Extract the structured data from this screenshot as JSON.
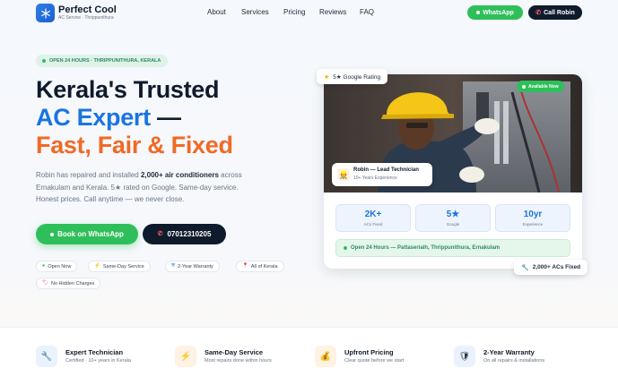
{
  "nav": {
    "brand": "Perfect Cool",
    "tagline": "AC Service · Thrippunithura",
    "links": [
      "About",
      "Services",
      "Pricing",
      "Reviews",
      "FAQ"
    ],
    "whatsapp_label": "WhatsApp",
    "call_label": "Call Robin"
  },
  "hero": {
    "badge": "OPEN 24 HOURS · THRIPPUNITHURA, KERALA",
    "line1": "Kerala's Trusted",
    "line2": "AC Expert",
    "line2_dash": " —",
    "line3": "Fast, Fair & Fixed",
    "lede_a": "Robin has repaired and installed ",
    "lede_b": "2,000+ air conditioners",
    "lede_c": " across Ernakulam and Kerala. 5★ rated on Google. Same-day service. Honest prices. Call anytime — we never close.",
    "cta_whatsapp": "Book on WhatsApp",
    "cta_phone": "07012310205",
    "chips": [
      {
        "icon": "green-dot",
        "label": "Open Now"
      },
      {
        "icon": "bolt-icon",
        "label": "Same-Day Service"
      },
      {
        "icon": "shield-icon",
        "label": "2-Year Warranty"
      },
      {
        "icon": "pin-icon",
        "label": "All of Kerala"
      },
      {
        "icon": "tag-icon",
        "label": "No Hidden Charges"
      }
    ]
  },
  "card": {
    "rating": "5★ Google Rating",
    "available": "Available Now",
    "tech_name": "Robin — Lead Technician",
    "tech_sub": "10+ Years Experience",
    "stats": [
      {
        "value": "2K+",
        "label": "ACs Fixed"
      },
      {
        "value": "5★",
        "label": "Google"
      },
      {
        "value": "10yr",
        "label": "Experience"
      }
    ],
    "open_bar": "Open 24 Hours — Pattaserialh, Thrippunithura, Ernakulam",
    "acs_fixed": "2,000+ ACs Fixed"
  },
  "features": [
    {
      "icon": "wrench-icon",
      "title": "Expert Technician",
      "sub": "Certified · 10+ years in Kerala",
      "bg": "#eaf2fd"
    },
    {
      "icon": "bolt-icon",
      "title": "Same-Day Service",
      "sub": "Most repairs done within hours",
      "bg": "#fdf2e3"
    },
    {
      "icon": "money-bag-icon",
      "title": "Upfront Pricing",
      "sub": "Clear quote before we start",
      "bg": "#fdf2e3"
    },
    {
      "icon": "shield-icon",
      "title": "2-Year Warranty",
      "sub": "On all repairs & installations",
      "bg": "#eaf2fd"
    }
  ],
  "colors": {
    "accent_blue": "#1a74e0",
    "accent_orange": "#f06a25",
    "whatsapp_green": "#2fbf5a",
    "dark_navy": "#0f1b2d"
  }
}
